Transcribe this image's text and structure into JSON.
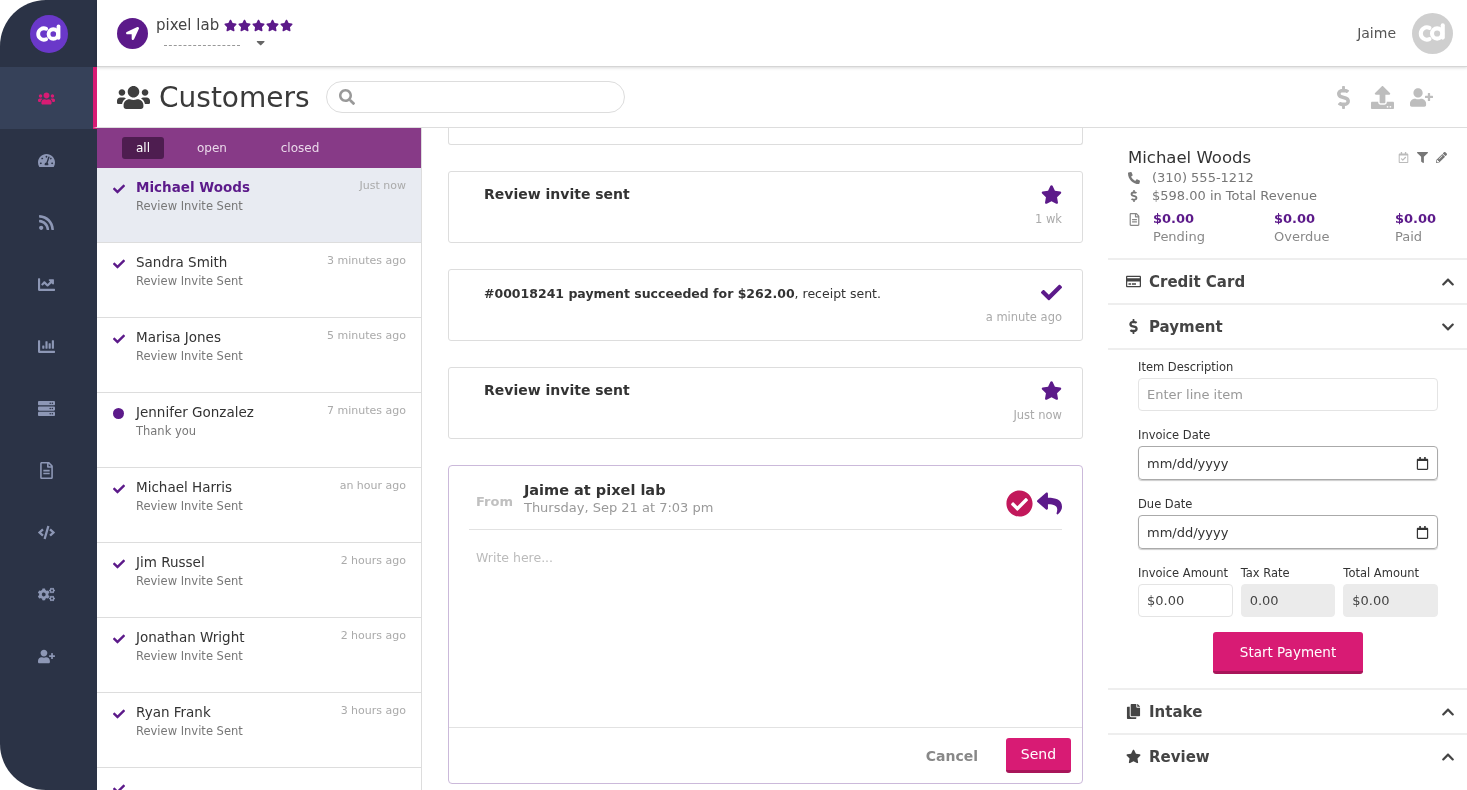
{
  "header": {
    "business": "pixel lab",
    "stars": 5,
    "user": "Jaime"
  },
  "nav": [
    {
      "kind": "customers",
      "selected": true
    },
    {
      "kind": "dashboard",
      "selected": false
    },
    {
      "kind": "feed",
      "selected": false
    },
    {
      "kind": "trends",
      "selected": false
    },
    {
      "kind": "reports",
      "selected": false
    },
    {
      "kind": "lists",
      "selected": false
    },
    {
      "kind": "documents",
      "selected": false
    },
    {
      "kind": "code",
      "selected": false
    },
    {
      "kind": "settings",
      "selected": false
    },
    {
      "kind": "add-user",
      "selected": false
    }
  ],
  "page": {
    "title": "Customers"
  },
  "tabs": [
    {
      "label": "all",
      "selected": true
    },
    {
      "label": "open",
      "selected": false
    },
    {
      "label": "closed",
      "selected": false
    }
  ],
  "customers": [
    {
      "name": "Michael Woods",
      "note": "Review Invite Sent",
      "time": "Just now",
      "kind": "sent",
      "selected": true
    },
    {
      "name": "Sandra Smith",
      "note": "Review Invite Sent",
      "time": "3 minutes ago",
      "kind": "sent",
      "selected": false
    },
    {
      "name": "Marisa Jones",
      "note": "Review Invite Sent",
      "time": "5 minutes ago",
      "kind": "sent",
      "selected": false
    },
    {
      "name": "Jennifer Gonzalez",
      "note": "Thank you",
      "time": "7 minutes ago",
      "kind": "unread",
      "selected": false
    },
    {
      "name": "Michael Harris",
      "note": "Review Invite Sent",
      "time": "an hour ago",
      "kind": "sent",
      "selected": false
    },
    {
      "name": "Jim Russel",
      "note": "Review Invite Sent",
      "time": "2 hours ago",
      "kind": "sent",
      "selected": false
    },
    {
      "name": "Jonathan Wright",
      "note": "Review Invite Sent",
      "time": "2 hours ago",
      "kind": "sent",
      "selected": false
    },
    {
      "name": "Ryan Frank",
      "note": "Review Invite Sent",
      "time": "3 hours ago",
      "kind": "sent",
      "selected": false
    },
    {
      "kind": "sent",
      "selected": false
    }
  ],
  "timeline": [
    {
      "kind": "review",
      "text": "Review invite sent",
      "time": "1 wk"
    },
    {
      "kind": "payment",
      "text": "**#00018241 payment succeeded for $262.00**, receipt sent.",
      "time": "a minute ago"
    },
    {
      "kind": "review",
      "text": "Review invite sent",
      "time": "Just now"
    }
  ],
  "composer": {
    "from_label": "From",
    "sender": "Jaime at pixel lab",
    "date": "Thursday, Sep 21 at 7:03 pm",
    "placeholder": "Write here...",
    "cancel": "Cancel",
    "send": "Send"
  },
  "contact": {
    "name": "Michael Woods",
    "phone": "(310) 555-1212",
    "revenue": "$598.00 in Total Revenue",
    "stats": [
      {
        "value": "$0.00",
        "label": "Pending"
      },
      {
        "value": "$0.00",
        "label": "Overdue"
      },
      {
        "value": "$0.00",
        "label": "Paid"
      }
    ]
  },
  "sections": [
    {
      "kind": "card",
      "title": "Credit Card",
      "expanded": false
    },
    {
      "kind": "payment",
      "title": "Payment",
      "expanded": true
    },
    {
      "kind": "intake",
      "title": "Intake",
      "expanded": false
    },
    {
      "kind": "review",
      "title": "Review",
      "expanded": false
    }
  ],
  "payment_form": {
    "description_label": "Item Description",
    "description_placeholder": "Enter line item",
    "invoice_date_label": "Invoice Date",
    "invoice_date": "mm/dd/yyyy",
    "due_date_label": "Due Date",
    "due_date": "mm/dd/yyyy",
    "amounts": [
      {
        "label": "Invoice Amount",
        "value": "$0.00",
        "disabled": false
      },
      {
        "label": "Tax Rate",
        "value": "0.00",
        "disabled": true
      },
      {
        "label": "Total Amount",
        "value": "$0.00",
        "disabled": true
      }
    ],
    "submit": "Start Payment"
  }
}
